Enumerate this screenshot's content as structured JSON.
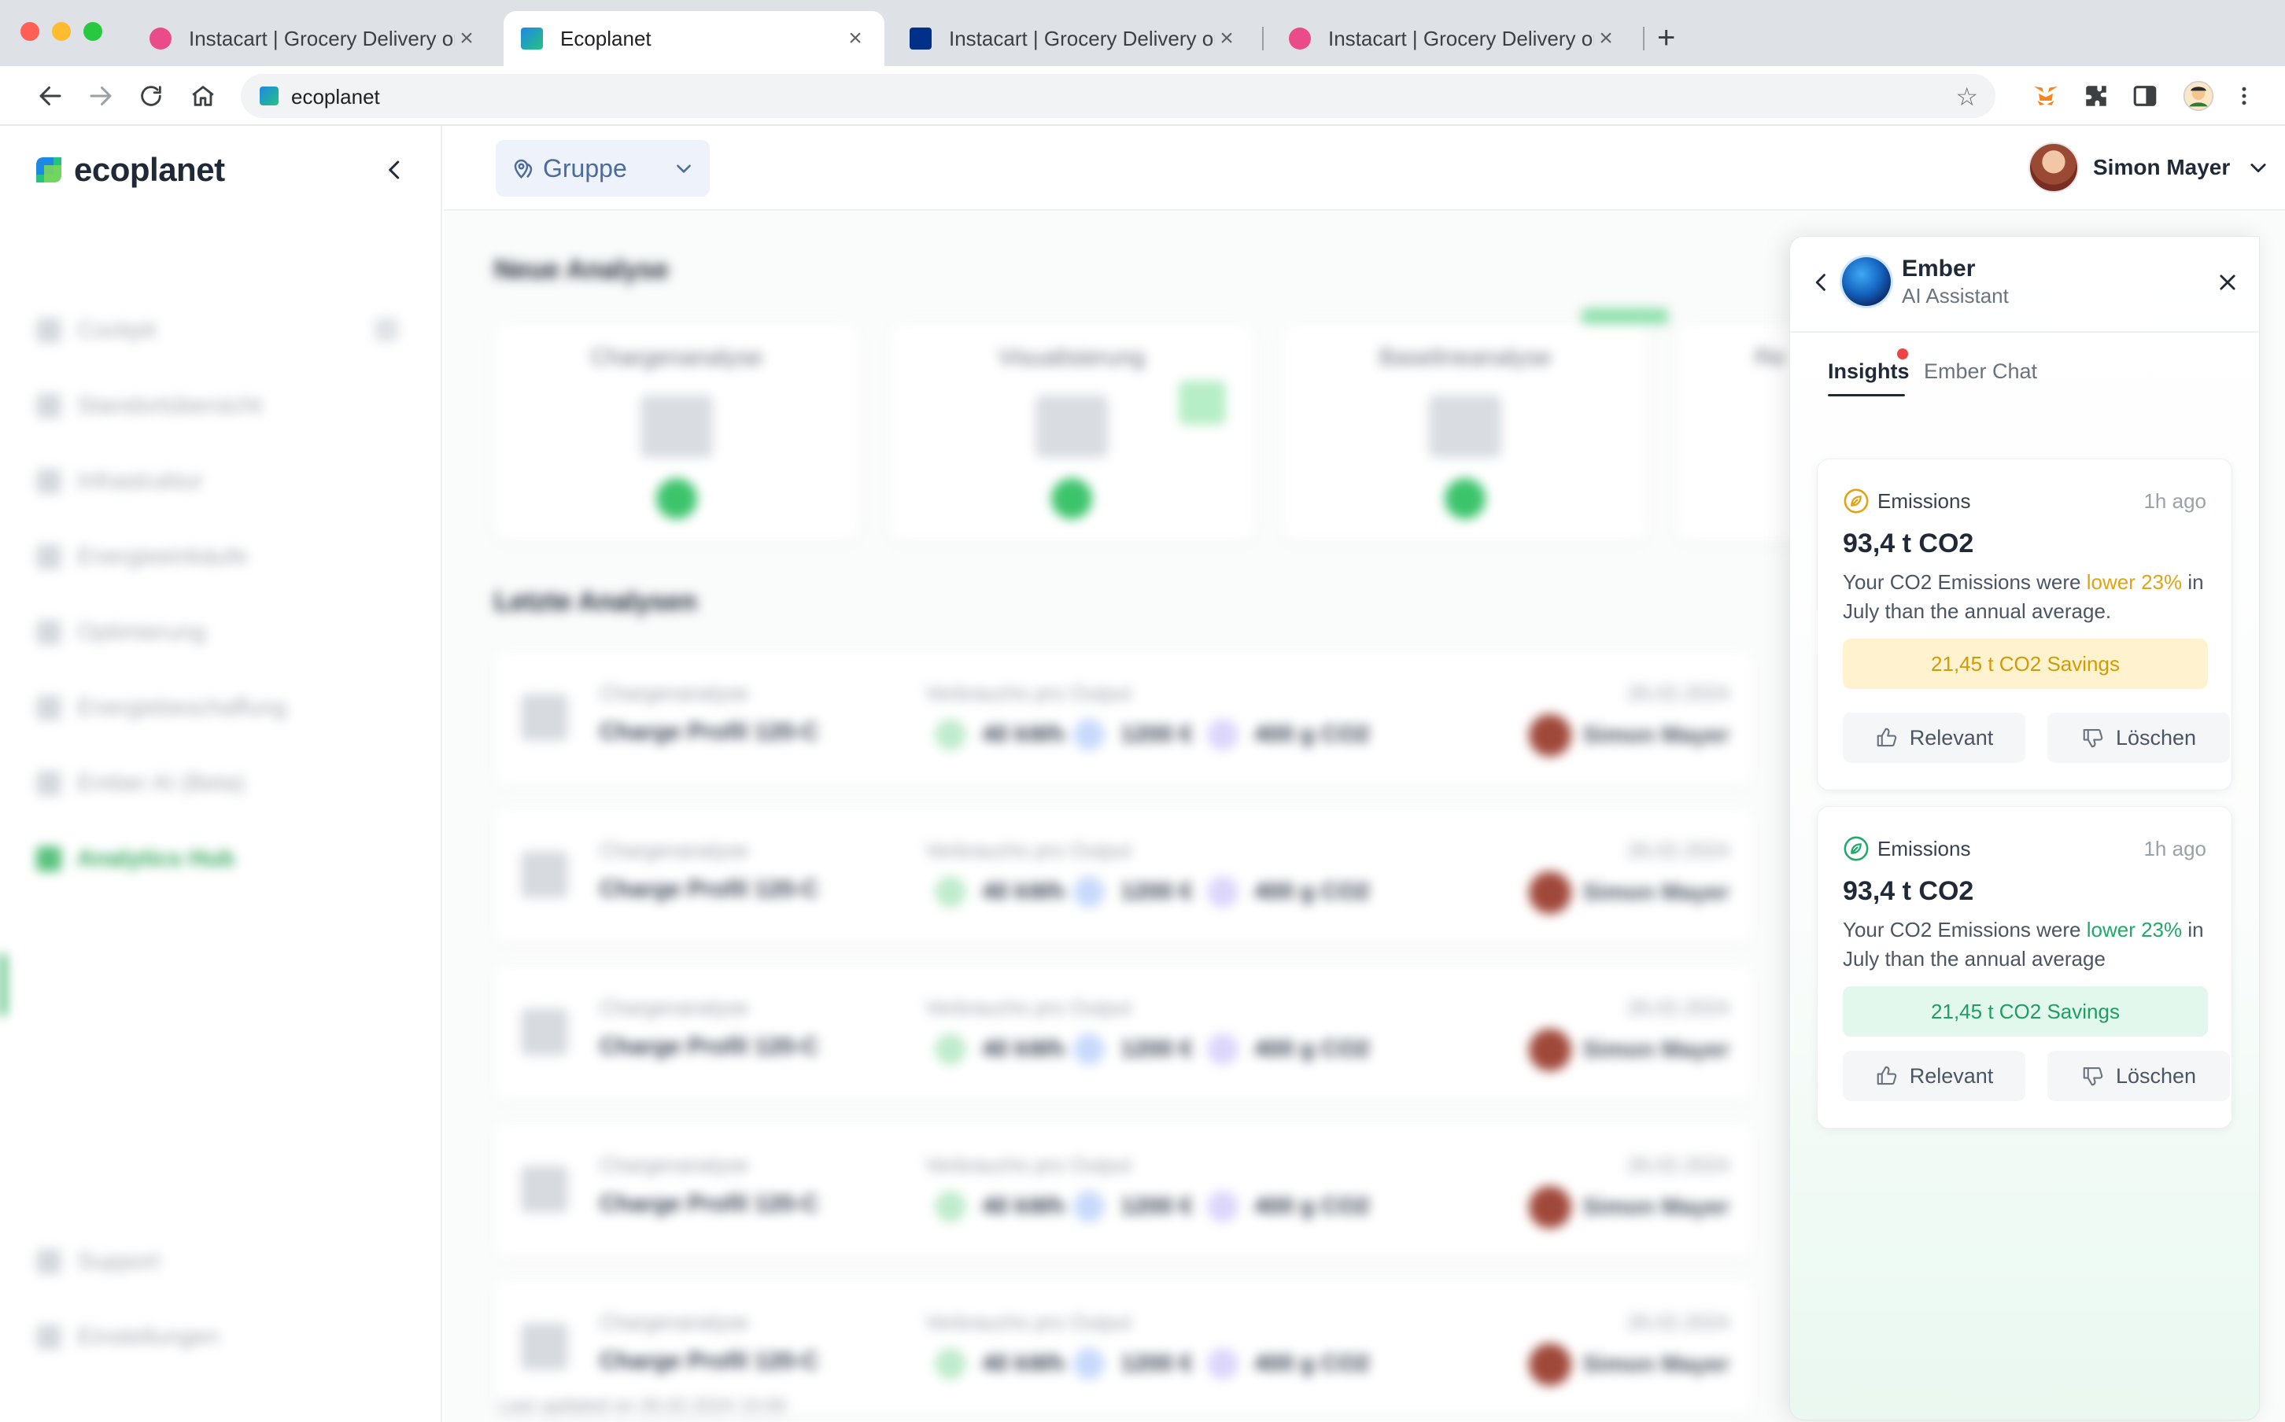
{
  "browser": {
    "tabs": [
      {
        "title": "Instacart | Grocery Delivery or",
        "favicon": "dribbble-icon",
        "active": false
      },
      {
        "title": "Ecoplanet",
        "favicon": "ecoplanet-icon",
        "active": true
      },
      {
        "title": "Instacart | Grocery Delivery or",
        "favicon": "paypal-icon",
        "active": false
      },
      {
        "title": "Instacart | Grocery Delivery or",
        "favicon": "dribbble-icon",
        "active": false
      }
    ],
    "tab_close": "×",
    "new_tab": "+",
    "url": "ecoplanet"
  },
  "sidebar": {
    "brand": "ecoplanet",
    "items": [
      {
        "label": "Cockpit"
      },
      {
        "label": "Standortübersicht"
      },
      {
        "label": "Infrastruktur"
      },
      {
        "label": "Energieeinkäufe"
      },
      {
        "label": "Optimierung"
      },
      {
        "label": "Energiebeschaffung"
      },
      {
        "label": "Ember AI (Beta)"
      },
      {
        "label": "Analytics Hub",
        "active": true
      }
    ],
    "bottom_items": [
      {
        "label": "Support"
      },
      {
        "label": "Einstellungen"
      }
    ]
  },
  "header": {
    "group_label": "Gruppe",
    "user_name": "Simon Mayer"
  },
  "main": {
    "new_analysis_title": "Neue Analyse",
    "analysis_cards": [
      {
        "title": "Chargenanalyse"
      },
      {
        "title": "Visualisierung"
      },
      {
        "title": "Baselineanalyse"
      },
      {
        "title": "Re"
      }
    ],
    "recent_title": "Letzte Analysen",
    "rows": [
      {
        "type": "Chargenanalyse",
        "name": "Charge Profil 120-C",
        "kpi_head": "Verbrauchs pro Output",
        "kwh": "40 kWh",
        "eur": "1200 €",
        "co2": "400 g CO2",
        "date": "26.02.2024",
        "user": "Simon Mayer"
      },
      {
        "type": "Chargenanalyse",
        "name": "Charge Profil 120-C",
        "kpi_head": "Verbrauchs pro Output",
        "kwh": "40 kWh",
        "eur": "1200 €",
        "co2": "400 g CO2",
        "date": "26.02.2024",
        "user": "Simon Mayer"
      },
      {
        "type": "Chargenanalyse",
        "name": "Charge Profil 120-C",
        "kpi_head": "Verbrauchs pro Output",
        "kwh": "40 kWh",
        "eur": "1200 €",
        "co2": "400 g CO2",
        "date": "26.02.2024",
        "user": "Simon Mayer"
      },
      {
        "type": "Chargenanalyse",
        "name": "Charge Profil 120-C",
        "kpi_head": "Verbrauchs pro Output",
        "kwh": "40 kWh",
        "eur": "1200 €",
        "co2": "400 g CO2",
        "date": "26.02.2024",
        "user": "Simon Mayer"
      },
      {
        "type": "Chargenanalyse",
        "name": "Charge Profil 120-C",
        "kpi_head": "Verbrauchs pro Output",
        "kwh": "40 kWh",
        "eur": "1200 €",
        "co2": "400 g CO2",
        "date": "26.02.2024",
        "user": "Simon Mayer"
      }
    ],
    "footnote": "Last updated on 26.02.2024 15:00"
  },
  "ember": {
    "name": "Ember",
    "subtitle": "AI Assistant",
    "tabs": [
      {
        "label": "Insights",
        "active": true
      },
      {
        "label": "Ember Chat",
        "active": false
      }
    ],
    "insights": [
      {
        "category": "Emissions",
        "time": "1h ago",
        "value": "93,4 t CO2",
        "text_before": "Your CO2 Emissions were ",
        "highlight": "lower 23%",
        "text_after": " in July than the annual average.",
        "banner": "21,45 t CO2 Savings",
        "accent": "#e0a313",
        "relevant_label": "Relevant",
        "delete_label": "Löschen"
      },
      {
        "category": "Emissions",
        "time": "1h ago",
        "value": "93,4 t CO2",
        "text_before": "Your CO2 Emissions were ",
        "highlight": "lower 23%",
        "text_after": " in July than the annual average",
        "banner": "21,45 t CO2 Savings",
        "accent": "#1fa96a",
        "relevant_label": "Relevant",
        "delete_label": "Löschen"
      }
    ]
  }
}
